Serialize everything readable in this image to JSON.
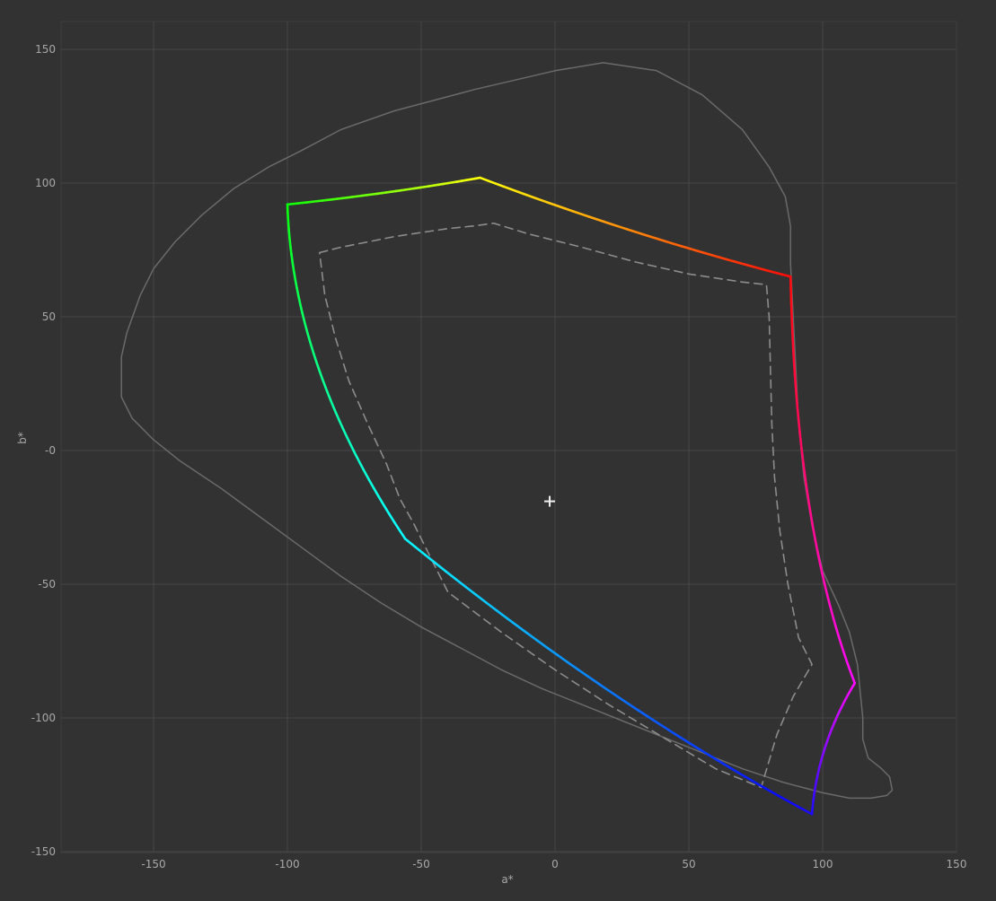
{
  "chart_data": {
    "type": "line",
    "title": "",
    "xlabel": "a*",
    "ylabel": "b*",
    "xlim": [
      -185,
      150
    ],
    "ylim": [
      -150,
      160
    ],
    "xticks": [
      -150,
      -100,
      -50,
      0,
      50,
      100,
      150
    ],
    "xtick_labels": [
      "-150",
      "-100",
      "-50",
      "0",
      "50",
      "100",
      "150"
    ],
    "yticks": [
      150,
      100,
      50,
      0,
      -50,
      -100,
      -150
    ],
    "ytick_labels": [
      "150",
      "100",
      "50",
      "-0",
      "-50",
      "-100",
      "-150"
    ],
    "grid": true,
    "colors": {
      "background": "#323232",
      "grid": "#474747",
      "outline": "#6a6a6a",
      "dashed": "#8c8c8c",
      "text": "#a8a8a8",
      "white_point": "#f0f0f0"
    },
    "white_point": {
      "a": -2,
      "b": -19
    },
    "series": [
      {
        "style": "solid-thin",
        "x": [
          18,
          0,
          -30,
          -60,
          -80,
          -95,
          -107,
          -120,
          -132,
          -142,
          -150,
          -155,
          -160,
          -162,
          -162,
          -158,
          -150,
          -140,
          -125,
          -110,
          -95,
          -80,
          -65,
          -50,
          -35,
          -20,
          -5,
          10,
          25,
          40,
          55,
          70,
          85,
          100,
          110,
          118,
          124,
          126,
          125,
          122,
          117,
          115,
          115,
          114,
          113,
          110,
          106,
          100,
          96,
          93,
          91,
          90,
          89,
          88,
          88,
          86,
          80,
          70,
          55,
          38,
          18
        ],
        "y": [
          145,
          142,
          135,
          127,
          120,
          112,
          106,
          98,
          88,
          78,
          68,
          58,
          44,
          35,
          20,
          12,
          4,
          -4,
          -14,
          -25,
          -36,
          -47,
          -57,
          -66,
          -74,
          -82,
          -89,
          -95,
          -101,
          -107,
          -113,
          -119,
          -124,
          -128,
          -130,
          -130,
          -129,
          -127,
          -122,
          -119,
          -115,
          -108,
          -100,
          -90,
          -80,
          -68,
          -58,
          -45,
          -28,
          -10,
          10,
          30,
          50,
          70,
          84,
          95,
          106,
          120,
          133,
          142,
          145
        ]
      },
      {
        "style": "dashed",
        "x": [
          -88,
          -80,
          -70,
          -60,
          -50,
          -40,
          -30,
          -23,
          -10,
          10,
          30,
          50,
          70,
          79,
          80,
          80.5,
          81,
          82,
          84,
          87,
          91,
          96,
          89,
          83,
          77,
          60,
          40,
          20,
          0,
          -20,
          -40,
          -50,
          -53,
          -58,
          -63,
          -70,
          -77,
          -82,
          -86,
          -88
        ],
        "y": [
          74,
          76,
          78,
          80,
          81.5,
          83,
          84,
          85,
          81,
          76,
          70.5,
          66,
          63,
          62,
          50,
          30,
          10,
          -10,
          -30,
          -50,
          -70,
          -80,
          -92,
          -106,
          -126,
          -119,
          -107,
          -95,
          -82,
          -68,
          -53,
          -33,
          -27,
          -18,
          -5,
          10,
          26,
          42,
          58,
          74
        ]
      }
    ]
  }
}
